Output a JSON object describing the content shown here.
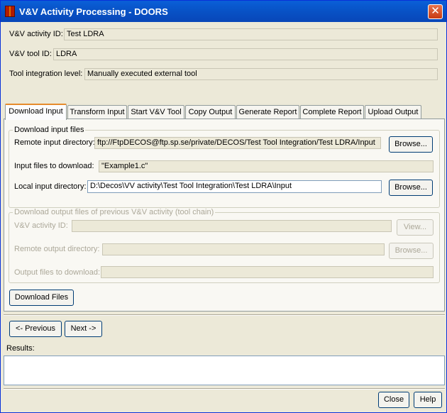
{
  "window": {
    "title": "V&V Activity Processing - DOORS",
    "close_glyph": "✕"
  },
  "header": {
    "activity_id_label": "V&V activity ID:",
    "activity_id_value": "Test LDRA",
    "tool_id_label": "V&V tool ID:",
    "tool_id_value": "LDRA",
    "integration_label": "Tool integration level:",
    "integration_value": "Manually executed external tool"
  },
  "tabs": [
    {
      "label": "Download Input",
      "active": true
    },
    {
      "label": "Transform Input"
    },
    {
      "label": "Start V&V Tool"
    },
    {
      "label": "Copy Output"
    },
    {
      "label": "Generate Report"
    },
    {
      "label": "Complete Report"
    },
    {
      "label": "Upload Output"
    }
  ],
  "download_input": {
    "group_title": "Download input files",
    "remote_dir_label": "Remote input directory:",
    "remote_dir_value": "ftp://FtpDECOS@ftp.sp.se/private/DECOS/Test Tool Integration/Test LDRA/Input",
    "browse_label": "Browse...",
    "files_label": "Input files to download:",
    "files_value": "\"Example1.c\"",
    "local_dir_label": "Local input directory:",
    "local_dir_value": "D:\\Decos\\VV activity\\Test Tool Integration\\Test LDRA\\Input",
    "browse2_label": "Browse..."
  },
  "previous_output": {
    "group_title": "Download output files of previous V&V activity (tool chain)",
    "activity_id_label": "V&V activity ID:",
    "view_label": "View...",
    "remote_dir_label": "Remote output directory:",
    "browse_label": "Browse...",
    "files_label": "Output files to download:"
  },
  "download_files_label": "Download Files",
  "nav": {
    "previous_label": "<- Previous",
    "next_label": "Next ->"
  },
  "results_label": "Results:",
  "footer": {
    "close_label": "Close",
    "help_label": "Help"
  }
}
